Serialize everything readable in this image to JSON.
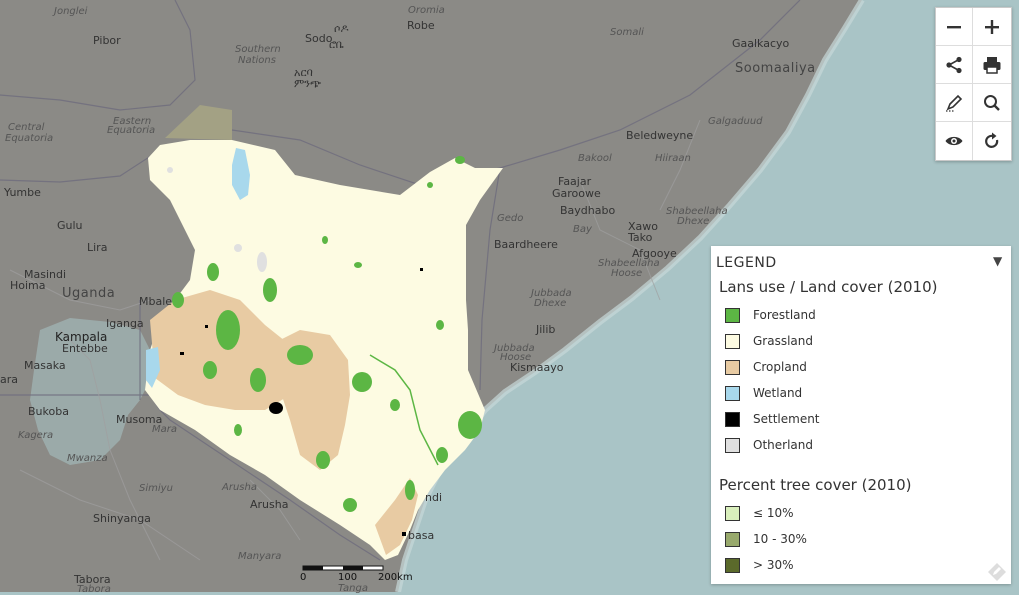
{
  "colors": {
    "water": "#a9c4c6",
    "land": "#8b8a86",
    "kenya_base": "#fdfbe2",
    "forestland": "#5cb644",
    "cropland": "#e8cba3",
    "wetland": "#a8d8ec",
    "settlement": "#000000",
    "otherland": "#e0e0e0",
    "tree_low": "#d9efbc",
    "tree_mid": "#98a96c",
    "tree_high": "#5b6a2b"
  },
  "map": {
    "places": [
      {
        "text": "Jonglei",
        "kind": "region"
      },
      {
        "text": "Pibor",
        "kind": "town"
      },
      {
        "text": "Southern",
        "kind": "region"
      },
      {
        "text": "Nations",
        "kind": "region"
      },
      {
        "text": "Sodo",
        "kind": "town"
      },
      {
        "text": "ሶዶ",
        "kind": "town"
      },
      {
        "text": "Oromia",
        "kind": "region"
      },
      {
        "text": "Robe",
        "kind": "town"
      },
      {
        "text": "ሮቤ",
        "kind": "town"
      },
      {
        "text": "አርባ",
        "kind": "town"
      },
      {
        "text": "ምንጭ",
        "kind": "town"
      },
      {
        "text": "Somali",
        "kind": "region"
      },
      {
        "text": "Gaalkacyo",
        "kind": "town"
      },
      {
        "text": "Soomaaliya",
        "kind": "country"
      },
      {
        "text": "Central",
        "kind": "region"
      },
      {
        "text": "Equatoria",
        "kind": "region"
      },
      {
        "text": "Eastern",
        "kind": "region"
      },
      {
        "text": "Equatoria",
        "kind": "region"
      },
      {
        "text": "Galgaduud",
        "kind": "region"
      },
      {
        "text": "Beledweyne",
        "kind": "town"
      },
      {
        "text": "Bakool",
        "kind": "region"
      },
      {
        "text": "Hiiraan",
        "kind": "region"
      },
      {
        "text": "Yumbe",
        "kind": "town"
      },
      {
        "text": "Faajar",
        "kind": "town"
      },
      {
        "text": "Garoowe",
        "kind": "town"
      },
      {
        "text": "Gedo",
        "kind": "region"
      },
      {
        "text": "Baydhabo",
        "kind": "town"
      },
      {
        "text": "Shabeellaha",
        "kind": "region"
      },
      {
        "text": "Dhexe",
        "kind": "region"
      },
      {
        "text": "Gulu",
        "kind": "town"
      },
      {
        "text": "Xawo",
        "kind": "town"
      },
      {
        "text": "Tako",
        "kind": "town"
      },
      {
        "text": "Bay",
        "kind": "region"
      },
      {
        "text": "Lira",
        "kind": "town"
      },
      {
        "text": "Baardheere",
        "kind": "town"
      },
      {
        "text": "Afgooye",
        "kind": "town"
      },
      {
        "text": "Shabeellaha",
        "kind": "region"
      },
      {
        "text": "Hoose",
        "kind": "region"
      },
      {
        "text": "Masindi",
        "kind": "town"
      },
      {
        "text": "Hoima",
        "kind": "town"
      },
      {
        "text": "Uganda",
        "kind": "country"
      },
      {
        "text": "Mbale",
        "kind": "town"
      },
      {
        "text": "Jubbada",
        "kind": "region"
      },
      {
        "text": "Dhexe",
        "kind": "region"
      },
      {
        "text": "Jilib",
        "kind": "town"
      },
      {
        "text": "Kampala",
        "kind": "city"
      },
      {
        "text": "Entebbe",
        "kind": "town"
      },
      {
        "text": "Iganga",
        "kind": "town"
      },
      {
        "text": "Jubbada",
        "kind": "region"
      },
      {
        "text": "Hoose",
        "kind": "region"
      },
      {
        "text": "Masaka",
        "kind": "town"
      },
      {
        "text": "Kismaayo",
        "kind": "town"
      },
      {
        "text": "ara",
        "kind": "town"
      },
      {
        "text": "Bukoba",
        "kind": "town"
      },
      {
        "text": "Musoma",
        "kind": "town"
      },
      {
        "text": "Mara",
        "kind": "region"
      },
      {
        "text": "Kagera",
        "kind": "region"
      },
      {
        "text": "Mwanza",
        "kind": "region"
      },
      {
        "text": "Simiyu",
        "kind": "region"
      },
      {
        "text": "Arusha",
        "kind": "region"
      },
      {
        "text": "Arusha",
        "kind": "town"
      },
      {
        "text": "Shinyanga",
        "kind": "town"
      },
      {
        "text": "Manyara",
        "kind": "region"
      },
      {
        "text": "Tabora",
        "kind": "town"
      },
      {
        "text": "Tabora",
        "kind": "region"
      },
      {
        "text": "Tanga",
        "kind": "region"
      },
      {
        "text": "ndi",
        "kind": "town"
      },
      {
        "text": "basa",
        "kind": "town"
      }
    ],
    "scalebar": {
      "labels": [
        "0",
        "100",
        "200km"
      ]
    }
  },
  "toolbar": {
    "buttons": [
      {
        "name": "zoom-out-button",
        "icon": "minus-icon"
      },
      {
        "name": "zoom-in-button",
        "icon": "plus-icon"
      },
      {
        "name": "share-button",
        "icon": "share-icon"
      },
      {
        "name": "print-button",
        "icon": "print-icon"
      },
      {
        "name": "draw-button",
        "icon": "pencil-icon"
      },
      {
        "name": "search-button",
        "icon": "search-icon"
      },
      {
        "name": "visibility-button",
        "icon": "eye-icon"
      },
      {
        "name": "reset-button",
        "icon": "refresh-icon"
      }
    ]
  },
  "legend": {
    "title": "LEGEND",
    "toggle": "▼",
    "land_section_title": "Lans use / Land cover (2010)",
    "land_items": [
      {
        "label": "Forestland",
        "color": "#5cb644"
      },
      {
        "label": "Grassland",
        "color": "#fdfbe2"
      },
      {
        "label": "Cropland",
        "color": "#e8cba3"
      },
      {
        "label": "Wetland",
        "color": "#a8d8ec"
      },
      {
        "label": "Settlement",
        "color": "#000000"
      },
      {
        "label": "Otherland",
        "color": "#e0e0e0"
      }
    ],
    "tree_section_title": "Percent tree cover (2010)",
    "tree_items": [
      {
        "label": "≤ 10%",
        "color": "#d9efbc"
      },
      {
        "label": "10 - 30%",
        "color": "#98a96c"
      },
      {
        "label": "> 30%",
        "color": "#5b6a2b"
      }
    ]
  }
}
